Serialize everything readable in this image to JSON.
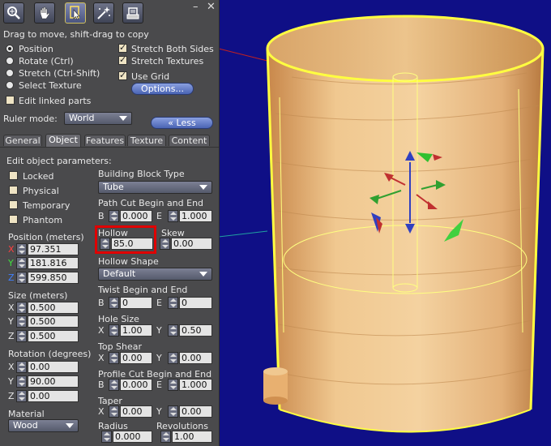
{
  "toolbar": {
    "tools": [
      {
        "name": "magnify-tool-icon"
      },
      {
        "name": "hand-grab-tool-icon"
      },
      {
        "name": "edit-pointer-tool-icon",
        "selected": true
      },
      {
        "name": "create-wand-tool-icon"
      },
      {
        "name": "land-tool-icon"
      }
    ],
    "minimize": "–",
    "close": "✕"
  },
  "hint": "Drag to move, shift-drag to copy",
  "modes": {
    "position": "Position",
    "rotate": "Rotate (Ctrl)",
    "stretch": "Stretch (Ctrl-Shift)",
    "select_texture": "Select Texture",
    "selected": "position"
  },
  "options": {
    "stretch_both": "Stretch Both Sides",
    "stretch_textures": "Stretch Textures",
    "use_grid": "Use Grid",
    "options_button": "Options...",
    "edit_linked": "Edit linked parts"
  },
  "ruler": {
    "label": "Ruler mode:",
    "value": "World",
    "less_button": "« Less"
  },
  "tabs": [
    {
      "label": "General"
    },
    {
      "label": "Object",
      "active": true
    },
    {
      "label": "Features"
    },
    {
      "label": "Texture"
    },
    {
      "label": "Content"
    }
  ],
  "object": {
    "heading": "Edit object parameters:",
    "flags": {
      "locked": "Locked",
      "physical": "Physical",
      "temporary": "Temporary",
      "phantom": "Phantom"
    },
    "position": {
      "label": "Position (meters)",
      "x": "97.351",
      "y": "181.816",
      "z": "599.850"
    },
    "size": {
      "label": "Size (meters)",
      "x": "0.500",
      "y": "0.500",
      "z": "0.500"
    },
    "rotation": {
      "label": "Rotation (degrees)",
      "x": "0.00",
      "y": "90.00",
      "z": "0.00"
    },
    "material": {
      "label": "Material",
      "value": "Wood"
    },
    "axis": {
      "x": "X",
      "y": "Y",
      "z": "Z"
    },
    "building_block": {
      "label": "Building Block Type",
      "value": "Tube"
    },
    "path_cut": {
      "label": "Path Cut Begin and End",
      "b_label": "B",
      "b": "0.000",
      "e_label": "E",
      "e": "1.000"
    },
    "hollow": {
      "label": "Hollow",
      "value": "85.0"
    },
    "skew": {
      "label": "Skew",
      "value": "0.00"
    },
    "hollow_shape": {
      "label": "Hollow Shape",
      "value": "Default"
    },
    "twist": {
      "label": "Twist Begin and End",
      "b_label": "B",
      "b": "0",
      "e_label": "E",
      "e": "0"
    },
    "hole_size": {
      "label": "Hole Size",
      "x": "1.00",
      "y": "0.50"
    },
    "top_shear": {
      "label": "Top Shear",
      "x": "0.00",
      "y": "0.00"
    },
    "profile_cut": {
      "label": "Profile Cut Begin and End",
      "b_label": "B",
      "b": "0.000",
      "e_label": "E",
      "e": "1.000"
    },
    "taper": {
      "label": "Taper",
      "x": "0.00",
      "y": "0.00"
    },
    "radius": {
      "label": "Radius",
      "value": "0.000"
    },
    "revolutions": {
      "label": "Revolutions",
      "value": "1.00"
    }
  },
  "colors": {
    "sky": "#0f0f86",
    "wood": "#e8b880",
    "highlight": "#ffff40",
    "panel": "#4a4a4c",
    "axis_x": "#ff3030",
    "axis_y": "#30e030",
    "axis_z": "#3070ff",
    "annotation": "#e00000"
  }
}
